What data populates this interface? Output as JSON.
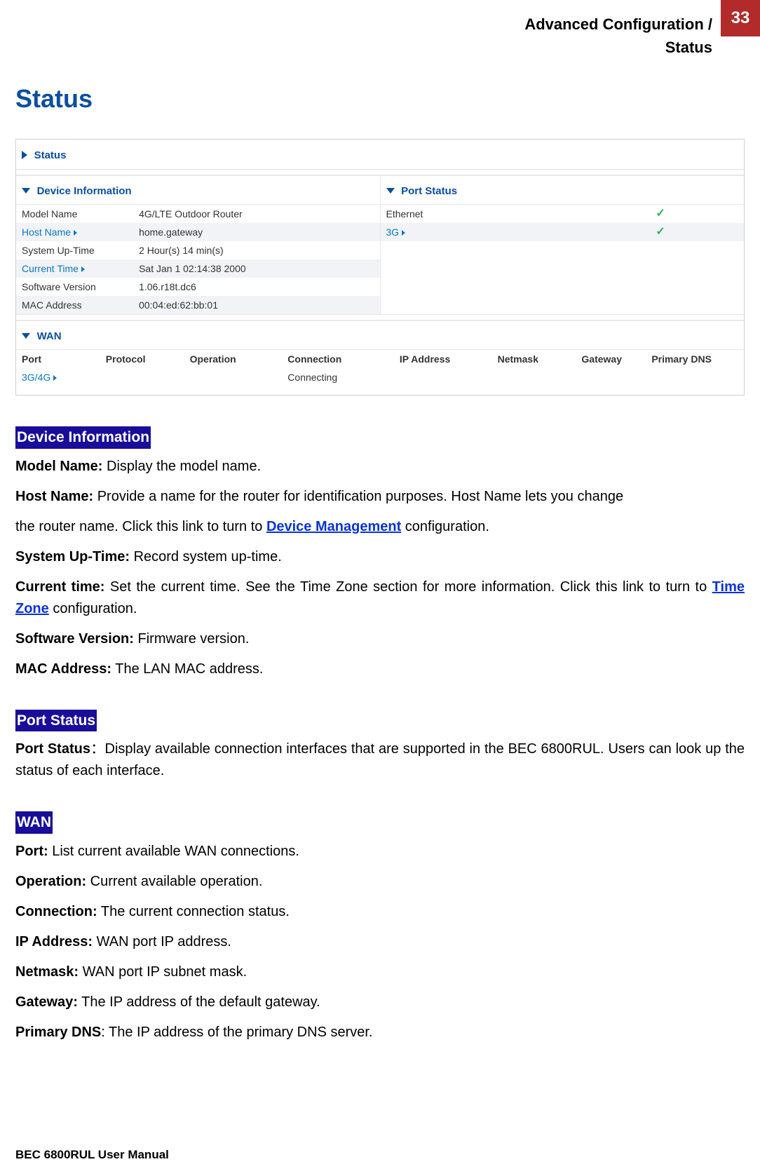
{
  "header": {
    "line1": "Advanced Configuration /",
    "line2": "Status",
    "page_number": "33"
  },
  "page_title": "Status",
  "screenshot": {
    "title": "Status",
    "device_info": {
      "header": "Device Information",
      "rows": [
        {
          "k": "Model Name",
          "v": "4G/LTE Outdoor Router",
          "link": false
        },
        {
          "k": "Host Name",
          "v": "home.gateway",
          "link": true
        },
        {
          "k": "System Up-Time",
          "v": "2 Hour(s) 14 min(s)",
          "link": false
        },
        {
          "k": "Current Time",
          "v": "Sat Jan 1 02:14:38 2000",
          "link": true
        },
        {
          "k": "Software Version",
          "v": "1.06.r18t.dc6",
          "link": false
        },
        {
          "k": "MAC Address",
          "v": "00:04:ed:62:bb:01",
          "link": false
        }
      ]
    },
    "port_status": {
      "header": "Port Status",
      "rows": [
        {
          "k": "Ethernet",
          "link": false,
          "ok": true
        },
        {
          "k": "3G",
          "link": true,
          "ok": true
        }
      ]
    },
    "wan": {
      "header": "WAN",
      "cols": [
        "Port",
        "Protocol",
        "Operation",
        "Connection",
        "IP Address",
        "Netmask",
        "Gateway",
        "Primary DNS"
      ],
      "row": {
        "port": "3G/4G",
        "protocol": "",
        "operation": "",
        "connection": "Connecting",
        "ip": "",
        "netmask": "",
        "gateway": "",
        "dns": ""
      }
    }
  },
  "sections": {
    "device_info_label": "Device Information",
    "port_status_label": "Port Status",
    "wan_label": "WAN",
    "device_info_items": {
      "model_name_k": "Model Name:",
      "model_name_v": " Display the model name.",
      "host_name_k": "Host Name:",
      "host_name_v1": " Provide a name for the router for identification purposes. Host Name lets you change",
      "host_name_v2a": "the router name. Click this link to turn to ",
      "host_name_link": "Device Management",
      "host_name_v2b": " configuration.",
      "sys_up_k": "System Up-Time:",
      "sys_up_v": " Record system up-time.",
      "curr_time_k": "Current time:",
      "curr_time_v1": " Set the current time. See the Time Zone section for more information. Click this link to turn to ",
      "curr_time_link": "Time Zone",
      "curr_time_v2": " configuration.",
      "sw_k": "Software Version:",
      "sw_v": " Firmware version.",
      "mac_k": "MAC Address:",
      "mac_v": " The LAN MAC address."
    },
    "port_status_items": {
      "ps_k": "Port Status",
      "ps_v": "：Display available connection interfaces that are supported in the BEC 6800RUL. Users can look up the status of each interface."
    },
    "wan_items": {
      "port_k": "Port:",
      "port_v": " List current available WAN connections.",
      "op_k": "Operation:",
      "op_v": " Current available operation.",
      "conn_k": "Connection:",
      "conn_v": " The current connection status.",
      "ip_k": "IP Address: ",
      "ip_v": " WAN port IP address.",
      "net_k": "Netmask:",
      "net_v": " WAN port IP subnet mask.",
      "gw_k": "Gateway:",
      "gw_v": " The IP address of the default gateway.",
      "dns_k": "Primary DNS",
      "dns_v": ": The IP address of the primary DNS server."
    }
  },
  "footer": "BEC 6800RUL User Manual"
}
